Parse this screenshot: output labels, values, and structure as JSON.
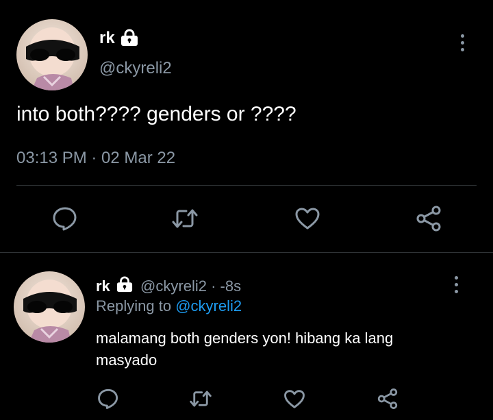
{
  "main_tweet": {
    "display_name": "rk",
    "handle": "@ckyreli2",
    "text": "into both???? genders or ????",
    "timestamp": "03:13 PM · 02 Mar 22"
  },
  "reply": {
    "display_name": "rk",
    "handle": "@ckyreli2",
    "time": "· -8s",
    "replying_prefix": "Replying to",
    "replying_handle": "@ckyreli2",
    "text_line1": "malamang both genders yon! hibang ka lang",
    "text_line2": "masyado"
  },
  "icons": {
    "verified_lock": "lock-icon",
    "more": "more-vertical-icon",
    "reply": "comment-icon",
    "retweet": "retweet-icon",
    "like": "heart-icon",
    "share": "share-icon"
  },
  "colors": {
    "background": "#000000",
    "text": "#ffffff",
    "muted": "#8b98a5",
    "link": "#1d9bf0"
  }
}
